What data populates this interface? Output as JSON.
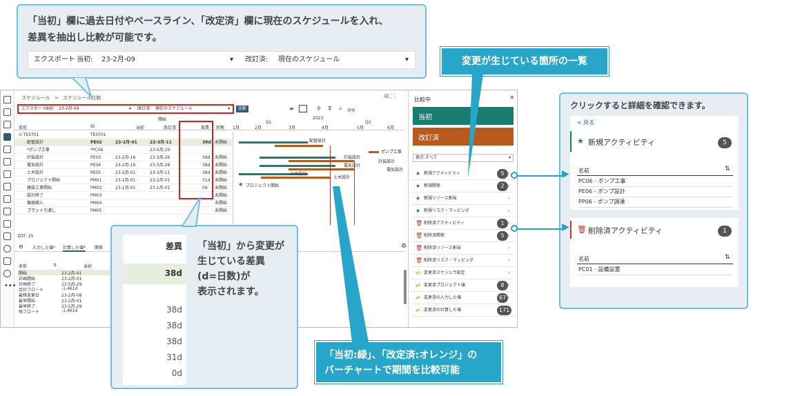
{
  "callout_top": {
    "text_line1": "「当初」欄に過去日付やベースライン、「改定済」欄に現在のスケジュールを入れ、",
    "text_line2": "差異を抽出し比較が可能です。",
    "export": "エクスポート",
    "baseline_label": "当初:",
    "baseline_value": "23-2月-09",
    "revised_label": "改訂済:",
    "revised_value": "現在のスケジュール",
    "caret": "▾"
  },
  "diff_banner": "変更が生じている箇所の一覧",
  "detail_caption": "クリックすると詳細を確認できます。",
  "bottom_banner_line1": "「当初:緑」、「改定済:オレンジ」の",
  "bottom_banner_line2": "バーチャートで期間を比較可能",
  "mid_callout": {
    "header": "差異",
    "highlight": "38d",
    "values": [
      "38d",
      "38d",
      "38d",
      "31d",
      "0d"
    ],
    "text1": "「当初」から変更が",
    "text2": "生じている差異",
    "text3": "(d=日数)が",
    "text4": "表示されます。"
  },
  "app": {
    "breadcrumb1": "スケジュール",
    "breadcrumb_sep": ">",
    "breadcrumb2": "スケジュール比較",
    "toolbar": {
      "export": "エクスポート",
      "baseline_label": "当初:",
      "baseline_value": "23-2月-09",
      "revised_label": "改訂済:",
      "revised_value": "現在のスケジュール",
      "compare_btn": "比較",
      "search": "検索"
    },
    "columns": {
      "group": "開始",
      "name": "名前",
      "id": "ID",
      "baseline": "当初",
      "revised": "改訂済",
      "diff": "差異",
      "status": "状態"
    },
    "timeline": {
      "year": "2023",
      "q1": "Q1",
      "q2": "Q2",
      "months": [
        "1月",
        "2月",
        "3月",
        "4月",
        "5月",
        "6月"
      ]
    },
    "rows": [
      {
        "name": "⊙ TEST01",
        "id": "TEST01",
        "b": "",
        "r": "",
        "d": "",
        "s": ""
      },
      {
        "name": "配管設計",
        "id": "PE02",
        "b": "23-2月-01",
        "r": "23-3月-11",
        "d": "38d",
        "s": "未開始"
      },
      {
        "name": "*ポンプ工事",
        "id": "*PC06",
        "b": "",
        "r": "23-5月-20",
        "d": "",
        "s": ""
      },
      {
        "name": "計装設計",
        "id": "PE03",
        "b": "23-2月-16",
        "r": "23-3月-26",
        "d": "38d",
        "s": "未開始"
      },
      {
        "name": "電気設計",
        "id": "PE04",
        "b": "23-2月-16",
        "r": "23-3月-26",
        "d": "38d",
        "s": "未開始"
      },
      {
        "name": "土木設計",
        "id": "PE05",
        "b": "23-2月-01",
        "r": "23-3月-11",
        "d": "38d",
        "s": "未開始"
      },
      {
        "name": "プロジェクト開始",
        "id": "PM01",
        "b": "23-1月-01",
        "r": "23-2月-01",
        "d": "31d",
        "s": "未開始"
      },
      {
        "name": "建設工事開始",
        "id": "PM02",
        "b": "23-1月-01",
        "r": "23-1月-01",
        "d": "0d",
        "s": "未開始"
      },
      {
        "name": "設計終了",
        "id": "PM03",
        "b": "",
        "r": "",
        "d": "",
        "s": "未開始"
      },
      {
        "name": "機器搬入",
        "id": "PM04",
        "b": "",
        "r": "",
        "d": "",
        "s": "未開始"
      },
      {
        "name": "プラント引渡し",
        "id": "PM05",
        "b": "",
        "r": "",
        "d": "",
        "s": "未開始"
      }
    ],
    "bar_labels": {
      "b1": "配管設計",
      "b2": "ポンプ工事",
      "b3": "計装設計",
      "b4": "電気設計",
      "b5": "計装設計",
      "b6": "電気設計",
      "b7": "土木設計",
      "b8": "土木設計",
      "b9": "プロジェクト開始"
    },
    "total": "合計: 25",
    "bottom_tabs": [
      "入力した値*",
      "計算した値*",
      "関係"
    ],
    "bottom_cols": {
      "name": "名前",
      "val": "当初"
    },
    "bottom_rows": [
      {
        "n": "開始",
        "v": "23-2月-01"
      },
      {
        "n": "計画開始",
        "v": "23-2月-01"
      },
      {
        "n": "計画終了",
        "v": "23-5月-29"
      },
      {
        "n": "合計フロート",
        "v": "-1,461d"
      },
      {
        "n": "最終変更日",
        "v": "23-2月-08"
      },
      {
        "n": "最早開始",
        "v": "23-2月-01"
      },
      {
        "n": "最早終了",
        "v": "23-5月-29"
      },
      {
        "n": "残フロート",
        "v": "-1,461d"
      }
    ]
  },
  "compare_panel": {
    "title": "比較中",
    "baseline": "当初",
    "revised": "改訂済",
    "filter": "表示:すべて",
    "items": [
      {
        "label": "新規アクティビティ",
        "count": "5"
      },
      {
        "label": "新規関係",
        "count": "2"
      },
      {
        "label": "新規リソース割当",
        "count": ""
      },
      {
        "label": "新規リスク・マッピング",
        "count": ""
      },
      {
        "label": "削除済アクティビティ",
        "count": "1"
      },
      {
        "label": "削除済関係",
        "count": "5"
      },
      {
        "label": "削除済リソース割当",
        "count": ""
      },
      {
        "label": "削除済リスク・マッピング",
        "count": ""
      },
      {
        "label": "変更済スケジュラ設定",
        "count": ""
      },
      {
        "label": "変更済プロジェクト値",
        "count": "8"
      },
      {
        "label": "変更済の入力した値",
        "count": "67"
      },
      {
        "label": "変更済の計算した値",
        "count": "171"
      }
    ]
  },
  "detail": {
    "back": "< 戻る",
    "new_title": "新規アクティビティ",
    "new_count": "5",
    "name_col": "名前",
    "new_items": [
      "PC06 - ポンプ工事",
      "PE06 - ポンプ設計",
      "PP06 - ポンプ調達"
    ],
    "del_title": "削除済アクティビティ",
    "del_count": "1",
    "del_items": [
      "PC01 - 設備設置"
    ]
  },
  "colors": {
    "teal": "#1a7d72",
    "orange": "#b85a1e",
    "callout_blue": "#27a6c9",
    "highlight": "#e6eedd"
  }
}
